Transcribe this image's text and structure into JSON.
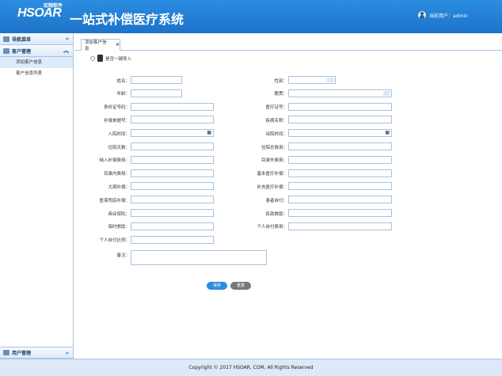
{
  "header": {
    "logo_small": "宏翔软件",
    "logo_text": "HSOAR",
    "title": "一站式补偿医疗系统",
    "current_user": "当前用户：admin"
  },
  "sidebar": {
    "nav_title": "导航菜单",
    "group_title": "客户管理",
    "items": [
      {
        "label": "添加客户信息",
        "active": true
      },
      {
        "label": "客户信息列表",
        "active": false
      }
    ],
    "bottom_title": "用户管理"
  },
  "tab": {
    "label": "添加客户信息",
    "close": "×"
  },
  "import": {
    "label": "是否一键导入"
  },
  "form": {
    "left": [
      {
        "label": "姓名：",
        "type": "text",
        "value": ""
      },
      {
        "label": "年龄：",
        "type": "text",
        "value": ""
      },
      {
        "label": "身份证号码：",
        "type": "text",
        "value": ""
      },
      {
        "label": "补偿单据号：",
        "type": "text",
        "value": ""
      },
      {
        "label": "入院时间：",
        "type": "date",
        "value": ""
      },
      {
        "label": "住院天数：",
        "type": "text",
        "value": ""
      },
      {
        "label": "纳入补偿费用：",
        "type": "text",
        "value": ""
      },
      {
        "label": "目录内费用：",
        "type": "text",
        "value": ""
      },
      {
        "label": "大病补偿：",
        "type": "text",
        "value": ""
      },
      {
        "label": "医保兜底补偿：",
        "type": "text",
        "value": ""
      },
      {
        "label": "商业保险：",
        "type": "text",
        "value": ""
      },
      {
        "label": "临时救助：",
        "type": "text",
        "value": ""
      },
      {
        "label": "个人自付比例：",
        "type": "text",
        "value": ""
      }
    ],
    "right": [
      {
        "label": "性别：",
        "type": "select",
        "value": ""
      },
      {
        "label": "籍贯：",
        "type": "select",
        "value": ""
      },
      {
        "label": "医疗证号：",
        "type": "text",
        "value": ""
      },
      {
        "label": "疾病名称：",
        "type": "text",
        "value": ""
      },
      {
        "label": "出院时间：",
        "type": "date",
        "value": ""
      },
      {
        "label": "住院总费用：",
        "type": "text",
        "value": ""
      },
      {
        "label": "目录外费用：",
        "type": "text",
        "value": ""
      },
      {
        "label": "基本医疗补偿：",
        "type": "text",
        "value": ""
      },
      {
        "label": "补充医疗补偿：",
        "type": "text",
        "value": ""
      },
      {
        "label": "患者自付：",
        "type": "text",
        "value": ""
      },
      {
        "label": "民政救助：",
        "type": "text",
        "value": ""
      },
      {
        "label": "个人自付费用：",
        "type": "text",
        "value": ""
      }
    ],
    "remark_label": "备注：",
    "remark_value": ""
  },
  "buttons": {
    "save": "保存",
    "reset": "重置"
  },
  "footer": {
    "copyright": "Copyright © 2017 HSOAR. COM, All Rights Reserved"
  },
  "colors": {
    "header": "#1d73c9",
    "accent": "#2b8de0",
    "logo_o": "#f28c28"
  },
  "icons": {
    "user": "user-icon",
    "nav": "menu-icon",
    "group": "users-icon",
    "calendar": "calendar-icon",
    "file": "file-icon"
  }
}
